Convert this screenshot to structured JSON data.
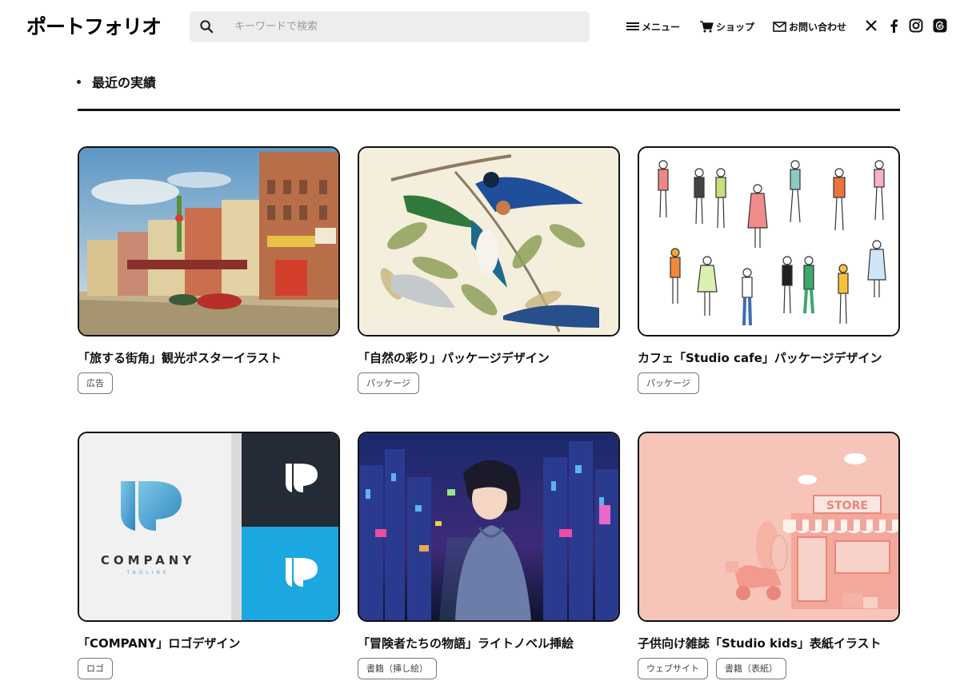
{
  "header": {
    "logo": "ポートフォリオ",
    "search_placeholder": "キーワードで検索",
    "nav": {
      "menu": "メニュー",
      "shop": "ショップ",
      "contact": "お問い合わせ"
    },
    "social_icons": [
      "x-icon",
      "facebook-icon",
      "instagram-icon",
      "threads-icon"
    ]
  },
  "section": {
    "title": "最近の実績"
  },
  "works": [
    {
      "title": "「旅する街角」観光ポスターイラスト",
      "tags": [
        "広告"
      ],
      "image": "vintage-street-postcard"
    },
    {
      "title": "「自然の彩り」パッケージデザイン",
      "tags": [
        "パッケージ"
      ],
      "image": "bird-botanical-illustration"
    },
    {
      "title": "カフェ「Studio cafe」パッケージデザイン",
      "tags": [
        "パッケージ"
      ],
      "image": "line-people-illustration"
    },
    {
      "title": "「COMPANY」ロゴデザイン",
      "tags": [
        "ロゴ"
      ],
      "image": "company-logo-mockup",
      "logo_text": "COMPANY",
      "logo_tagline": "TAGLINE"
    },
    {
      "title": "「冒険者たちの物語」ライトノベル挿絵",
      "tags": [
        "書籍（挿し絵）"
      ],
      "image": "anime-city-night"
    },
    {
      "title": "子供向け雑誌「Studio kids」表紙イラスト",
      "tags": [
        "ウェブサイト",
        "書籍（表紙）"
      ],
      "image": "pink-store-3d",
      "sign_text": "STORE"
    }
  ],
  "colors": {
    "accent": "#111111",
    "search_bg": "#ededed",
    "tag_border": "#777777"
  }
}
